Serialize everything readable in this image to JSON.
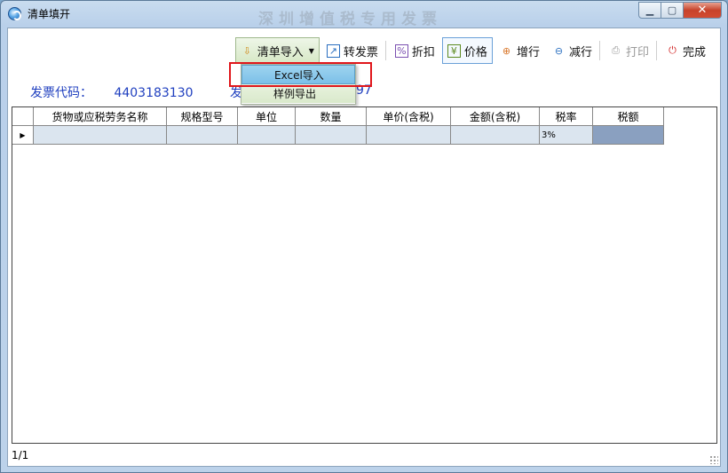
{
  "window": {
    "title": "清单填开",
    "ghost_title": "深圳增值税专用发票"
  },
  "toolbar": {
    "import_label": "清单导入",
    "to_invoice_label": "转发票",
    "discount_label": "折扣",
    "price_label": "价格",
    "add_row_label": "增行",
    "del_row_label": "减行",
    "print_label": "打印",
    "done_label": "完成"
  },
  "menu": {
    "items": [
      "Excel导入",
      "样例导出"
    ]
  },
  "invoice": {
    "code_label": "发票代码：",
    "code_value": "4403183130",
    "num_label_partial": "发",
    "num_value_partial": "97"
  },
  "grid": {
    "columns": [
      "货物或应税劳务名称",
      "规格型号",
      "单位",
      "数量",
      "单价(含税)",
      "金额(含税)",
      "税率",
      "税额"
    ],
    "row": {
      "tax_rate": "3%"
    }
  },
  "status": {
    "page": "1/1"
  },
  "colors": {
    "highlight_box": "#e0161b",
    "info_text": "#1f3fbf"
  }
}
